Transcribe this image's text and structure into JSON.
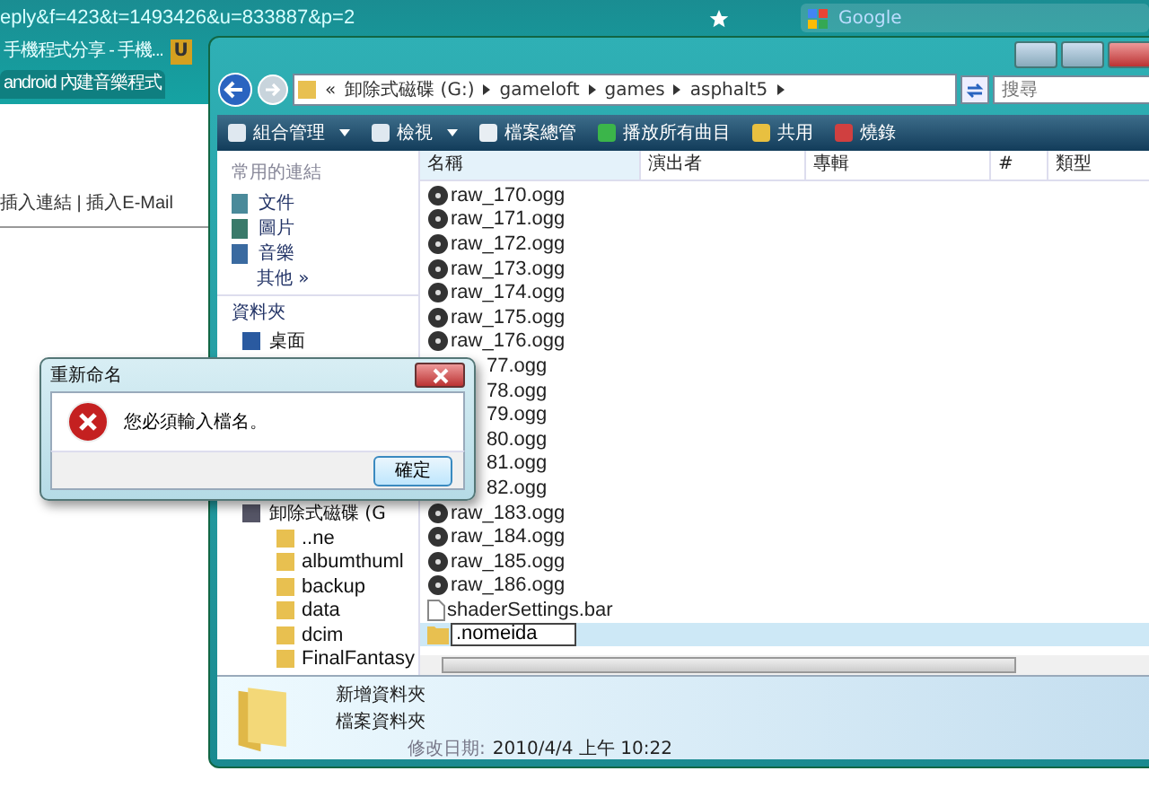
{
  "browser": {
    "url": "eply&f=423&t=1493426&u=833887&p=2",
    "search_placeholder": "Google",
    "extension_glyph": "U",
    "tabs": [
      {
        "label": "手機程式分享 - 手機...",
        "selected": false
      },
      {
        "label": "android 內建音樂程式",
        "selected": true
      }
    ],
    "page_links": "插入連結 | 插入E-Mail"
  },
  "explorer": {
    "breadcrumb_prefix": "«",
    "breadcrumb": [
      "卸除式磁碟 (G:)",
      "gameloft",
      "games",
      "asphalt5"
    ],
    "search_placeholder": "搜尋",
    "toolbar": [
      {
        "label": "組合管理",
        "dropdown": true,
        "kind": "organize"
      },
      {
        "label": "檢視",
        "dropdown": true,
        "kind": "views"
      },
      {
        "label": "檔案總管",
        "dropdown": false,
        "kind": "explorer"
      },
      {
        "label": "播放所有曲目",
        "dropdown": false,
        "kind": "play"
      },
      {
        "label": "共用",
        "dropdown": false,
        "kind": "share"
      },
      {
        "label": "燒錄",
        "dropdown": false,
        "kind": "burn"
      }
    ],
    "favorites_title": "常用的連結",
    "favorites": [
      {
        "label": "文件",
        "kind": "documents"
      },
      {
        "label": "圖片",
        "kind": "pictures"
      },
      {
        "label": "音樂",
        "kind": "music"
      }
    ],
    "more": "其他",
    "more_glyph": "»",
    "folders_title": "資料夾",
    "tree": [
      {
        "label": "桌面",
        "kind": "desktop"
      },
      {
        "label": "卸除式磁碟 (G",
        "kind": "drive",
        "children": [
          {
            "label": "..ne",
            "kind": "folder"
          },
          {
            "label": "albumthuml",
            "kind": "folder"
          },
          {
            "label": "backup",
            "kind": "folder"
          },
          {
            "label": "data",
            "kind": "folder"
          },
          {
            "label": "dcim",
            "kind": "folder"
          },
          {
            "label": "FinalFantasy",
            "kind": "folder"
          }
        ]
      }
    ],
    "columns": [
      "名稱",
      "演出者",
      "專輯",
      "#",
      "類型"
    ],
    "files": [
      {
        "name": "raw_170.ogg",
        "kind": "audio",
        "covered": false,
        "selected": false,
        "editing": false
      },
      {
        "name": "raw_171.ogg",
        "kind": "audio",
        "covered": false,
        "selected": false,
        "editing": false
      },
      {
        "name": "raw_172.ogg",
        "kind": "audio",
        "covered": false,
        "selected": false,
        "editing": false
      },
      {
        "name": "raw_173.ogg",
        "kind": "audio",
        "covered": false,
        "selected": false,
        "editing": false
      },
      {
        "name": "raw_174.ogg",
        "kind": "audio",
        "covered": false,
        "selected": false,
        "editing": false
      },
      {
        "name": "raw_175.ogg",
        "kind": "audio",
        "covered": false,
        "selected": false,
        "editing": false
      },
      {
        "name": "raw_176.ogg",
        "kind": "audio",
        "covered": false,
        "selected": false,
        "editing": false
      },
      {
        "name": "77.ogg",
        "covered": true,
        "selected": false,
        "editing": false
      },
      {
        "name": "78.ogg",
        "covered": true,
        "selected": false,
        "editing": false
      },
      {
        "name": "79.ogg",
        "covered": true,
        "selected": false,
        "editing": false
      },
      {
        "name": "80.ogg",
        "covered": true,
        "selected": false,
        "editing": false
      },
      {
        "name": "81.ogg",
        "covered": true,
        "selected": false,
        "editing": false
      },
      {
        "name": "82.ogg",
        "covered": true,
        "selected": false,
        "editing": false
      },
      {
        "name": "raw_183.ogg",
        "kind": "audio",
        "covered": false,
        "selected": false,
        "editing": false
      },
      {
        "name": "raw_184.ogg",
        "kind": "audio",
        "covered": false,
        "selected": false,
        "editing": false
      },
      {
        "name": "raw_185.ogg",
        "kind": "audio",
        "covered": false,
        "selected": false,
        "editing": false
      },
      {
        "name": "raw_186.ogg",
        "kind": "audio",
        "covered": false,
        "selected": false,
        "editing": false
      },
      {
        "name": "shaderSettings.bar",
        "kind": "file",
        "covered": false,
        "selected": false,
        "editing": false
      },
      {
        "name": ".nomeida",
        "kind": "folder",
        "covered": false,
        "selected": true,
        "editing": true
      }
    ],
    "details": {
      "name": "新增資料夾",
      "type": "檔案資料夾",
      "date_label": "修改日期:",
      "date": "2010/4/4 上午 10:22"
    }
  },
  "dialog": {
    "title": "重新命名",
    "message": "您必須輸入檔名。",
    "button": "確定"
  }
}
